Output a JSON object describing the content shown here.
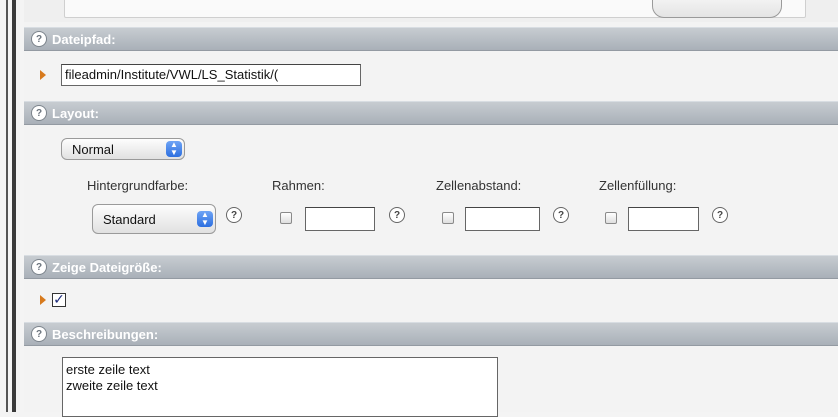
{
  "sections": {
    "dateipfad": {
      "title": "Dateipfad:",
      "value": "fileadmin/Institute/VWL/LS_Statistik/("
    },
    "layout": {
      "title": "Layout:",
      "layout_select": "Normal",
      "labels": {
        "hintergrundfarbe": "Hintergrundfarbe:",
        "rahmen": "Rahmen:",
        "zellenabstand": "Zellenabstand:",
        "zellenfuellung": "Zellenfüllung:"
      },
      "background_select": "Standard"
    },
    "dateigroesse": {
      "title": "Zeige Dateigröße:",
      "checked": true
    },
    "beschreibungen": {
      "title": "Beschreibungen:",
      "line1": "erste zeile text",
      "line2": "zweite zeile text"
    }
  },
  "icons": {
    "help": "?",
    "check": "✓"
  },
  "colors": {
    "section_bar": "#b0b7be",
    "arrow": "#d77a1d",
    "stepper": "#3b7be8"
  }
}
